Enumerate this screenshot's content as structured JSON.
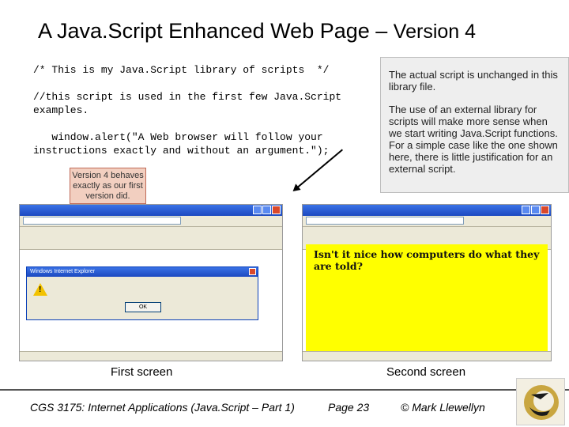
{
  "slide": {
    "title_main": "A Java.Script Enhanced Web Page",
    "title_dash": " – ",
    "title_version": "Version 4"
  },
  "code": {
    "lines": [
      "/* This is my Java.Script library of scripts  */",
      "",
      "//this script is used in the first few Java.Script examples.",
      "",
      "   window.alert(\"A Web browser will follow your instructions exactly and without an argument.\");"
    ]
  },
  "notes": {
    "para1": "The actual script is unchanged in this library file.",
    "para2": "The use of an external library for scripts will make more sense when we start writing Java.Script functions.  For a simple case like the one shown here, there is little justification for an external script."
  },
  "callout": {
    "text": "Version 4 behaves exactly as our first version did."
  },
  "screenshots": {
    "first": {
      "dialog_title": "Windows Internet Explorer",
      "dialog_ok": "OK",
      "caption": "First screen"
    },
    "second": {
      "page_heading": "Isn't it nice how computers do what they are told?",
      "caption": "Second screen"
    }
  },
  "footer": {
    "course": "CGS 3175: Internet Applications (Java.Script – Part 1)",
    "page": "Page 23",
    "author": "© Mark Llewellyn"
  },
  "colors": {
    "notes_bg": "#eeeeee",
    "callout_bg": "#f2cfc0",
    "page_bg_second": "#ffff00"
  }
}
